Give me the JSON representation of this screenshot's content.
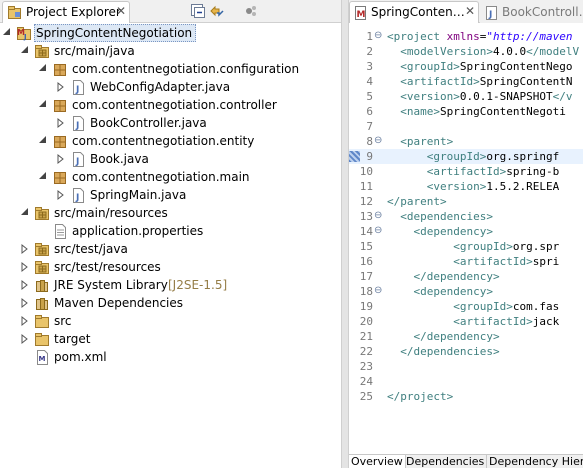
{
  "explorer": {
    "tab_label": "Project Explorer",
    "close_glyph": "✕",
    "toolbar": [
      "collapse-all-icon",
      "link-with-editor-icon",
      "view-menu-icon"
    ]
  },
  "tree": [
    {
      "label": "SpringContentNegotiation",
      "level": 0,
      "expanded": true,
      "icon": "maven-project-icon",
      "selected": true
    },
    {
      "label": "src/main/java",
      "level": 1,
      "expanded": true,
      "icon": "source-folder-icon"
    },
    {
      "label": "com.contentnegotiation.configuration",
      "level": 2,
      "expanded": true,
      "icon": "package-icon"
    },
    {
      "label": "WebConfigAdapter.java",
      "level": 3,
      "expanded": false,
      "icon": "java-file-icon"
    },
    {
      "label": "com.contentnegotiation.controller",
      "level": 2,
      "expanded": true,
      "icon": "package-icon"
    },
    {
      "label": "BookController.java",
      "level": 3,
      "expanded": false,
      "icon": "java-file-icon"
    },
    {
      "label": "com.contentnegotiation.entity",
      "level": 2,
      "expanded": true,
      "icon": "package-icon"
    },
    {
      "label": "Book.java",
      "level": 3,
      "expanded": false,
      "icon": "java-file-icon"
    },
    {
      "label": "com.contentnegotiation.main",
      "level": 2,
      "expanded": true,
      "icon": "package-icon"
    },
    {
      "label": "SpringMain.java",
      "level": 3,
      "expanded": false,
      "icon": "java-file-icon"
    },
    {
      "label": "src/main/resources",
      "level": 1,
      "expanded": true,
      "icon": "source-folder-icon"
    },
    {
      "label": "application.properties",
      "level": 2,
      "expanded": null,
      "icon": "properties-file-icon"
    },
    {
      "label": "src/test/java",
      "level": 1,
      "expanded": false,
      "icon": "source-folder-icon"
    },
    {
      "label": "src/test/resources",
      "level": 1,
      "expanded": false,
      "icon": "source-folder-icon"
    },
    {
      "label": "JRE System Library",
      "decor": " [J2SE-1.5]",
      "level": 1,
      "expanded": false,
      "icon": "library-icon"
    },
    {
      "label": "Maven Dependencies",
      "level": 1,
      "expanded": false,
      "icon": "library-icon"
    },
    {
      "label": "src",
      "level": 1,
      "expanded": false,
      "icon": "folder-icon"
    },
    {
      "label": "target",
      "level": 1,
      "expanded": false,
      "icon": "folder-icon"
    },
    {
      "label": "pom.xml",
      "level": 1,
      "expanded": null,
      "icon": "xml-file-icon"
    }
  ],
  "editor": {
    "tabs": [
      {
        "label": "SpringConten…",
        "close_glyph": "✕",
        "active": true,
        "icon": "maven-pom-icon"
      },
      {
        "label": "BookControll…",
        "close_glyph": "",
        "active": false,
        "icon": "java-file-icon"
      }
    ],
    "lines": [
      {
        "n": "1",
        "fold": "⊖",
        "indent": 0,
        "html": "&lt;project xmlns=\"http://maven"
      },
      {
        "n": "2",
        "fold": "",
        "indent": 2,
        "tag": "modelVersion",
        "text": "4.0.0",
        "close": "&lt;/modelV"
      },
      {
        "n": "3",
        "fold": "",
        "indent": 2,
        "tag": "groupId",
        "text": "SpringContentNego",
        "close": ""
      },
      {
        "n": "4",
        "fold": "",
        "indent": 2,
        "tag": "artifactId",
        "text": "SpringContentN",
        "close": ""
      },
      {
        "n": "5",
        "fold": "",
        "indent": 2,
        "tag": "version",
        "text": "0.0.1-SNAPSHOT",
        "close": "&lt;/v"
      },
      {
        "n": "6",
        "fold": "",
        "indent": 2,
        "tag": "name",
        "text": "SpringContentNegoti",
        "close": ""
      },
      {
        "n": "7",
        "fold": "",
        "indent": 0
      },
      {
        "n": "8",
        "fold": "⊖",
        "indent": 2,
        "open": "parent"
      },
      {
        "n": "9",
        "fold": "",
        "indent": 6,
        "tag": "groupId",
        "text": "org.springf",
        "close": "",
        "current": true
      },
      {
        "n": "10",
        "fold": "",
        "indent": 6,
        "tag": "artifactId",
        "text": "spring-b",
        "close": ""
      },
      {
        "n": "11",
        "fold": "",
        "indent": 6,
        "tag": "version",
        "text": "1.5.2.RELEA",
        "close": ""
      },
      {
        "n": "12",
        "fold": "",
        "indent": 0,
        "closeonly": "parent"
      },
      {
        "n": "13",
        "fold": "⊖",
        "indent": 2,
        "open": "dependencies"
      },
      {
        "n": "14",
        "fold": "⊖",
        "indent": 4,
        "open": "dependency"
      },
      {
        "n": "15",
        "fold": "",
        "indent": 10,
        "tag": "groupId",
        "text": "org.spr",
        "close": ""
      },
      {
        "n": "16",
        "fold": "",
        "indent": 10,
        "tag": "artifactId",
        "text": "spri",
        "close": ""
      },
      {
        "n": "17",
        "fold": "",
        "indent": 4,
        "closeonly": "dependency"
      },
      {
        "n": "18",
        "fold": "⊖",
        "indent": 4,
        "open": "dependency"
      },
      {
        "n": "19",
        "fold": "",
        "indent": 10,
        "tag": "groupId",
        "text": "com.fas",
        "close": ""
      },
      {
        "n": "20",
        "fold": "",
        "indent": 10,
        "tag": "artifactId",
        "text": "jack",
        "close": ""
      },
      {
        "n": "21",
        "fold": "",
        "indent": 4,
        "closeonly": "dependency"
      },
      {
        "n": "22",
        "fold": "",
        "indent": 2,
        "closeonly": "dependencies"
      },
      {
        "n": "23",
        "fold": "",
        "indent": 0
      },
      {
        "n": "24",
        "fold": "",
        "indent": 0
      },
      {
        "n": "25",
        "fold": "",
        "indent": 0,
        "closeonly": "project"
      }
    ],
    "bottom_tabs": [
      "Overview",
      "Dependencies",
      "Dependency Hier"
    ]
  },
  "colors": {
    "tag": "#3f7f7f",
    "attr_name": "#7f007f",
    "attr_value": "#2a00ff",
    "selection": "#dde8f5",
    "current_line": "#e8f2fe"
  }
}
